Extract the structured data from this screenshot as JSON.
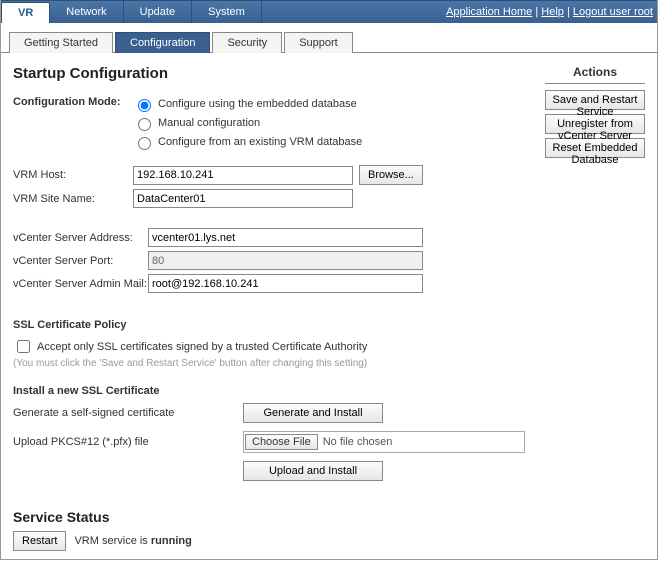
{
  "topNav": {
    "tabs": [
      "VR",
      "Network",
      "Update",
      "System"
    ],
    "activeIndex": 0,
    "links": {
      "appHome": "Application Home",
      "help": "Help",
      "logout": "Logout user root"
    }
  },
  "subNav": {
    "tabs": [
      "Getting Started",
      "Configuration",
      "Security",
      "Support"
    ],
    "activeIndex": 1
  },
  "page": {
    "title": "Startup Configuration"
  },
  "mode": {
    "label": "Configuration Mode:",
    "options": {
      "embedded": "Configure using the embedded database",
      "manual": "Manual configuration",
      "existing": "Configure from an existing VRM database"
    },
    "selected": "embedded"
  },
  "vrm": {
    "hostLabel": "VRM Host:",
    "hostValue": "192.168.10.241",
    "browseLabel": "Browse...",
    "siteLabel": "VRM Site Name:",
    "siteValue": "DataCenter01"
  },
  "vcenter": {
    "addrLabel": "vCenter Server Address:",
    "addrValue": "vcenter01.lys.net",
    "portLabel": "vCenter Server Port:",
    "portValue": "80",
    "mailLabel": "vCenter Server Admin Mail:",
    "mailValue": "root@192.168.10.241"
  },
  "ssl": {
    "policyTitle": "SSL Certificate Policy",
    "acceptOnly": "Accept only SSL certificates signed by a trusted Certificate Authority",
    "note": "(You must click the 'Save and Restart Service' button after changing this setting)",
    "installTitle": "Install a new SSL Certificate",
    "genLabel": "Generate a self-signed certificate",
    "genBtn": "Generate and Install",
    "uploadLabel": "Upload PKCS#12 (*.pfx) file",
    "chooseFile": "Choose File",
    "noFile": "No file chosen",
    "uploadBtn": "Upload and Install"
  },
  "actions": {
    "title": "Actions",
    "saveRestart": "Save and Restart Service",
    "unregister": "Unregister from vCenter Server",
    "resetDb": "Reset Embedded Database"
  },
  "service": {
    "title": "Service Status",
    "restart": "Restart",
    "statusPrefix": "VRM service is ",
    "statusValue": "running"
  }
}
